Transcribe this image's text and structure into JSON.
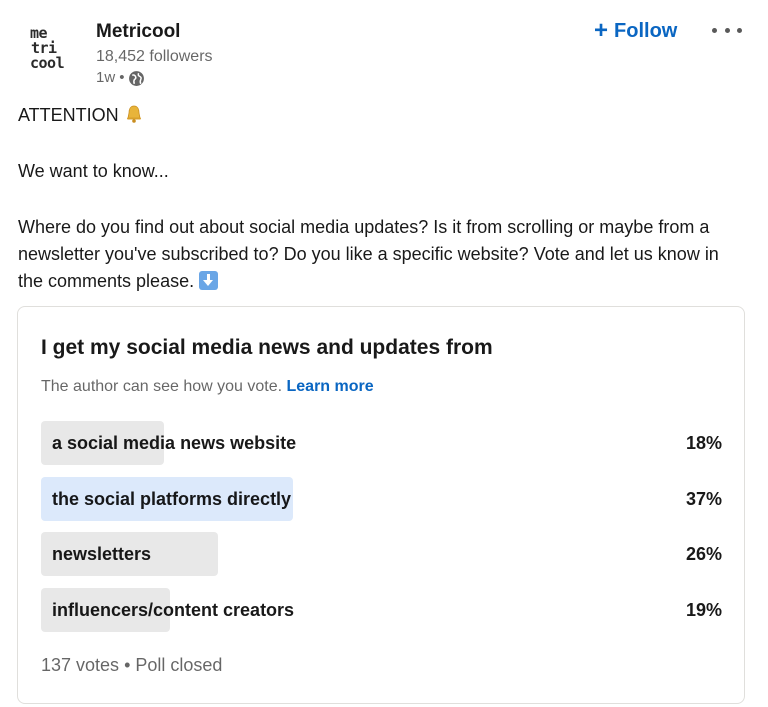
{
  "author": {
    "logo_lines": [
      "me",
      "tri",
      "cool"
    ],
    "name": "Metricool",
    "followers": "18,452 followers",
    "time": "1w",
    "visibility_icon": "globe-icon"
  },
  "actions": {
    "follow_label": "Follow",
    "follow_icon": "plus-icon",
    "more_icon": "ellipsis-icon"
  },
  "post": {
    "line1": "ATTENTION",
    "line1_icon": "bell-emoji",
    "line2": "We want to know...",
    "line3": "Where do you find out about social media updates? Is it from scrolling or maybe from a newsletter you've subscribed to? Do you like a specific website? Vote and let us know in the comments please.",
    "line3_icon": "down-arrow-emoji"
  },
  "poll": {
    "question": "I get my social media news and updates from",
    "note": "The author can see how you vote.",
    "learn_more": "Learn more",
    "options": [
      {
        "label": "a social media news website",
        "percent_text": "18%",
        "percent": 18,
        "selected": false
      },
      {
        "label": "the social platforms directly",
        "percent_text": "37%",
        "percent": 37,
        "selected": true
      },
      {
        "label": "newsletters",
        "percent_text": "26%",
        "percent": 26,
        "selected": false
      },
      {
        "label": "influencers/content creators",
        "percent_text": "19%",
        "percent": 19,
        "selected": false
      }
    ],
    "votes": "137 votes",
    "status": "Poll closed"
  },
  "colors": {
    "accent": "#0a66c2",
    "bar": "#e8e8e8",
    "bar_selected": "#dce9fb"
  }
}
